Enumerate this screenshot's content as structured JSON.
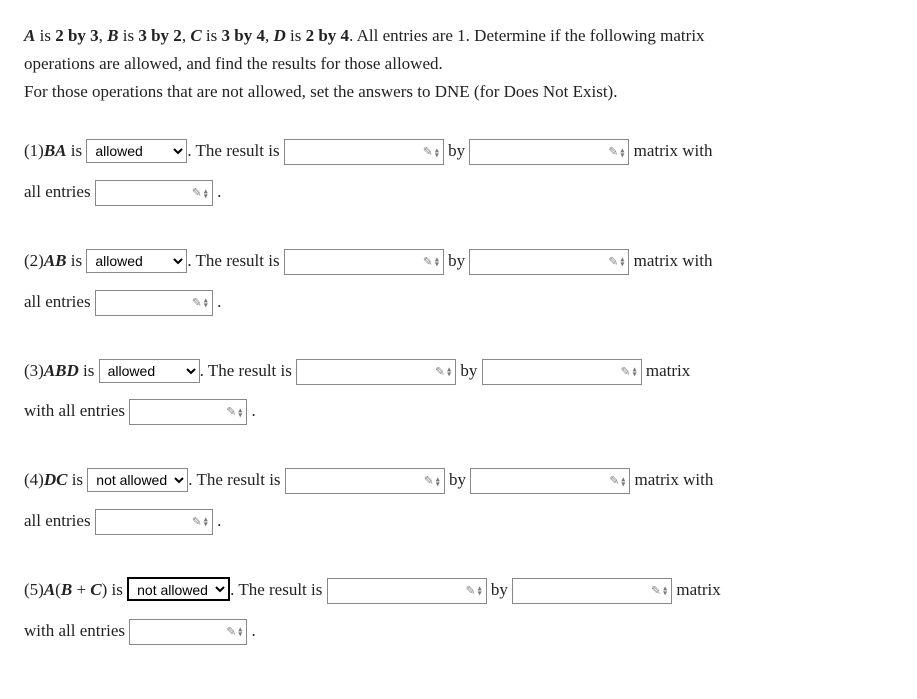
{
  "statement": {
    "line1_pre": " is ",
    "A": "A",
    "A_dim": "2 by 3",
    "B": "B",
    "B_dim": "3 by 2",
    "C": "C",
    "C_dim": "3 by 4",
    "D": "D",
    "D_dim": "2 by 4",
    "tail1": ". All entries are 1. Determine if the following matrix",
    "line2": "operations are allowed, and find the results for those allowed.",
    "line3": "For those operations that are not allowed, set the answers to DNE (for Does Not Exist)."
  },
  "dropdown": {
    "allowed": "allowed",
    "not_allowed": "not allowed"
  },
  "labels": {
    "is": " is ",
    "the_result_is": ". The result is ",
    "by": " by ",
    "matrix_with": " matrix with",
    "matrix": " matrix",
    "all_entries": "all entries ",
    "with_all_entries": "with all entries ",
    "period": " ."
  },
  "questions": {
    "q1": {
      "num": "(1)",
      "expr": "BA",
      "selected": "allowed"
    },
    "q2": {
      "num": "(2)",
      "expr": "AB",
      "selected": "allowed"
    },
    "q3": {
      "num": "(3)",
      "expr": "ABD",
      "selected": "allowed"
    },
    "q4": {
      "num": "(4)",
      "expr": "DC",
      "selected": "not allowed"
    },
    "q5": {
      "num": "(5)",
      "expr_pre": "A",
      "expr_paren_open": "(",
      "expr_B": "B",
      "expr_plus": " + ",
      "expr_C": "C",
      "expr_paren_close": ")",
      "selected": "not allowed"
    }
  }
}
